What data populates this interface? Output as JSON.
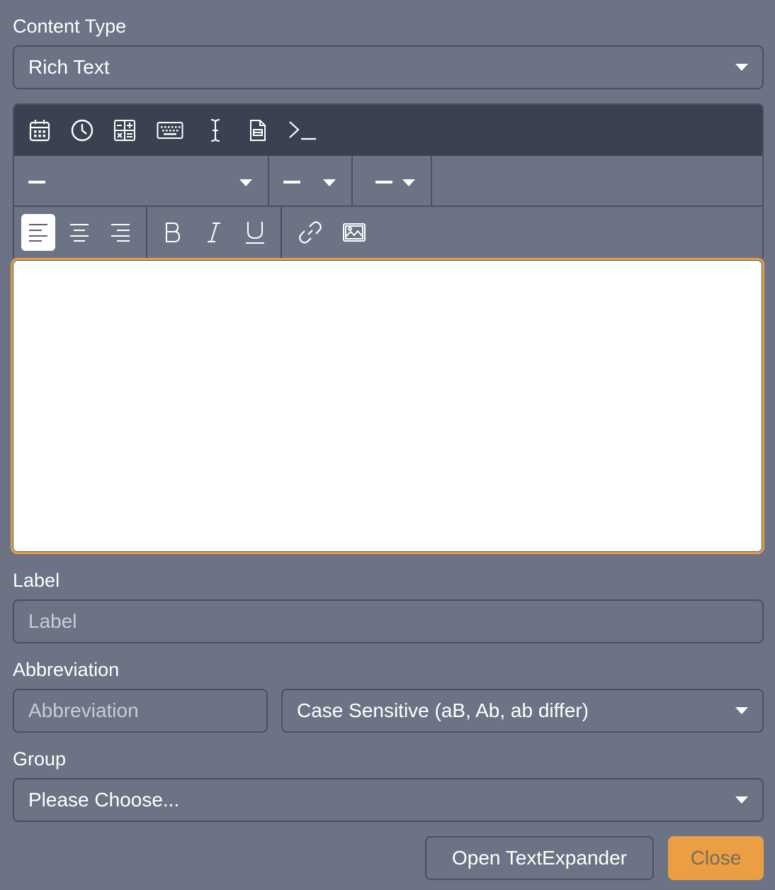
{
  "content_type": {
    "label": "Content Type",
    "selected": "Rich Text"
  },
  "editor": {
    "toolbar_icons": [
      "calendar-icon",
      "clock-icon",
      "calculator-icon",
      "keyboard-icon",
      "text-cursor-icon",
      "document-icon",
      "terminal-icon"
    ],
    "font_dropdowns": [
      "font-family",
      "font-size",
      "text-color"
    ],
    "format_buttons": [
      "align-left",
      "align-center",
      "align-right",
      "bold",
      "italic",
      "underline",
      "link",
      "image"
    ],
    "active_alignment": "align-left",
    "content": ""
  },
  "label_field": {
    "label": "Label",
    "placeholder": "Label",
    "value": ""
  },
  "abbreviation_field": {
    "label": "Abbreviation",
    "placeholder": "Abbreviation",
    "value": ""
  },
  "case_sensitivity": {
    "selected": "Case Sensitive (aB, Ab, ab differ)"
  },
  "group_field": {
    "label": "Group",
    "selected": "Please Choose..."
  },
  "buttons": {
    "open_textexpander": "Open TextExpander",
    "close": "Close"
  },
  "colors": {
    "background": "#6b7384",
    "toolbar": "#3a4252",
    "accent": "#eb9f42",
    "border": "#4a5160"
  }
}
